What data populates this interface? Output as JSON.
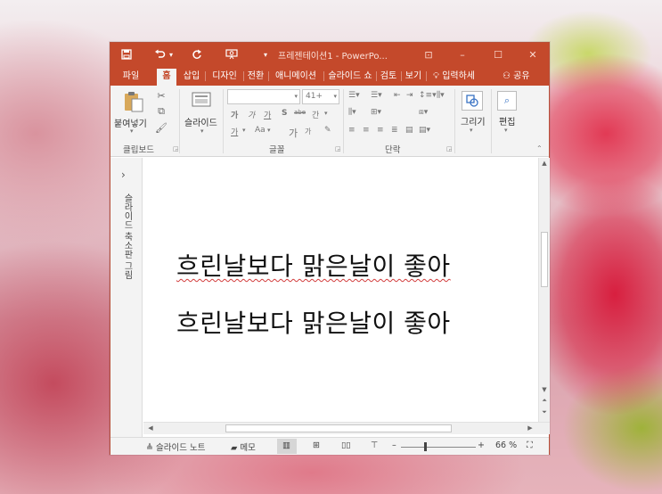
{
  "window": {
    "title": "프레젠테이션1 - PowerPo...",
    "quick_access": {
      "save": "🖫",
      "undo": "↶",
      "undo_dd": "▾",
      "redo": "↻",
      "customize": "▾"
    },
    "controls": {
      "ribbon_options": "⊡",
      "minimize": "–",
      "maximize": "☐",
      "close": "✕"
    }
  },
  "tabs": [
    {
      "label": "파일"
    },
    {
      "label": "홈",
      "active": true
    },
    {
      "label": "삽입"
    },
    {
      "label": "디자인"
    },
    {
      "label": "전환"
    },
    {
      "label": "애니메이션"
    },
    {
      "label": "슬라이드 쇼"
    },
    {
      "label": "검토"
    },
    {
      "label": "보기"
    }
  ],
  "tell_me": "입력하세",
  "share": "공유",
  "ribbon": {
    "clipboard": {
      "paste_label": "붙여넣기",
      "group_label": "클립보드"
    },
    "slides": {
      "new_slide_label": "슬라이드"
    },
    "font": {
      "font_name": "",
      "font_size": "41+",
      "group_label": "글꼴",
      "buttons": [
        "가",
        "가",
        "가",
        "S",
        "abe",
        "간"
      ],
      "row3": [
        "가",
        "Aa",
        "가",
        "가"
      ]
    },
    "paragraph": {
      "group_label": "단락"
    },
    "drawing": {
      "label": "그리기"
    },
    "editing": {
      "label": "편집"
    }
  },
  "thumbnails": {
    "label": "슬라이드 축소판 그림",
    "expand": "›"
  },
  "slide": {
    "lines": [
      "흐린날보다 맑은날이 좋아",
      "흐린날보다 맑은날이 좋아"
    ]
  },
  "statusbar": {
    "notes": "슬라이드 노트",
    "comments": "메모",
    "zoom_minus": "–",
    "zoom_plus": "+",
    "zoom": "66 %"
  },
  "colors": {
    "accent": "#c4492b",
    "ribbon_bg": "#f3f3f3",
    "spellcheck": "#d23c3c"
  }
}
